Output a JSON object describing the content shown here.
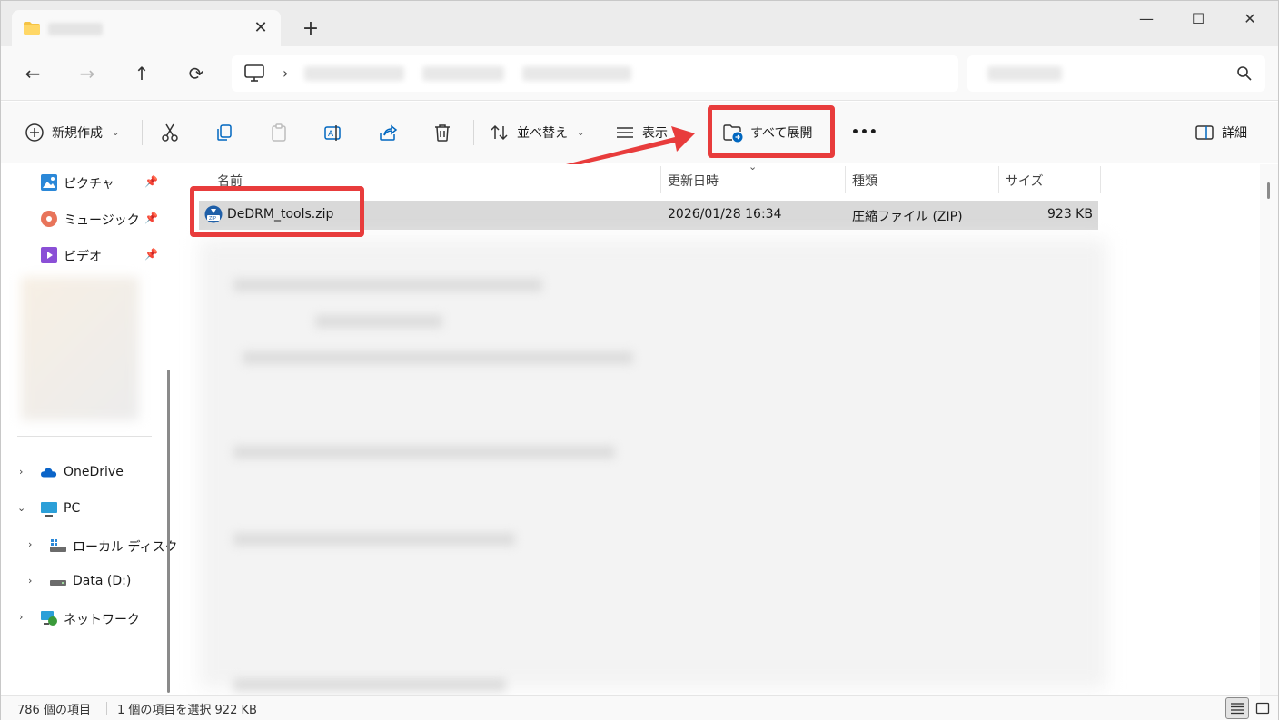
{
  "window": {
    "tab_close": "✕",
    "new_tab": "+",
    "minimize": "—",
    "maximize": "☐",
    "close": "✕"
  },
  "nav": {
    "back": "←",
    "forward": "→",
    "up": "↑",
    "refresh": "⟳",
    "breadcrumb_sep": "›"
  },
  "toolbar": {
    "new_label": "新規作成",
    "sort_label": "並べ替え",
    "view_label": "表示",
    "extract_all_label": "すべて展開",
    "more_label": "•••",
    "details_label": "詳細",
    "dropdown_caret": "⌄"
  },
  "sidebar": {
    "items": [
      {
        "label": "ピクチャ",
        "icon": "pictures-icon",
        "pinned": true
      },
      {
        "label": "ミュージック",
        "icon": "music-icon",
        "pinned": true
      },
      {
        "label": "ビデオ",
        "icon": "videos-icon",
        "pinned": true
      },
      {
        "label": "OneDrive",
        "icon": "cloud-icon",
        "expand": "›"
      },
      {
        "label": "PC",
        "icon": "pc-icon",
        "expand": "⌄"
      },
      {
        "label": "ローカル ディスク",
        "icon": "drive-icon",
        "expand": "›"
      },
      {
        "label": "Data (D:)",
        "icon": "drive-icon",
        "expand": "›"
      },
      {
        "label": "ネットワーク",
        "icon": "network-icon",
        "expand": "›"
      }
    ]
  },
  "columns": {
    "name": "名前",
    "modified": "更新日時",
    "type": "種類",
    "size": "サイズ",
    "sort_indicator": "⌄"
  },
  "files": [
    {
      "name": "DeDRM_tools.zip",
      "modified": "2026/01/28 16:34",
      "type": "圧縮ファイル (ZIP)",
      "size": "923 KB",
      "selected": true
    }
  ],
  "status": {
    "item_count": "786 個の項目",
    "selection": "1 個の項目を選択  922 KB"
  },
  "colors": {
    "highlight": "#e83c3c",
    "selected_row": "#d9d9d9",
    "accent": "#0067c0"
  }
}
